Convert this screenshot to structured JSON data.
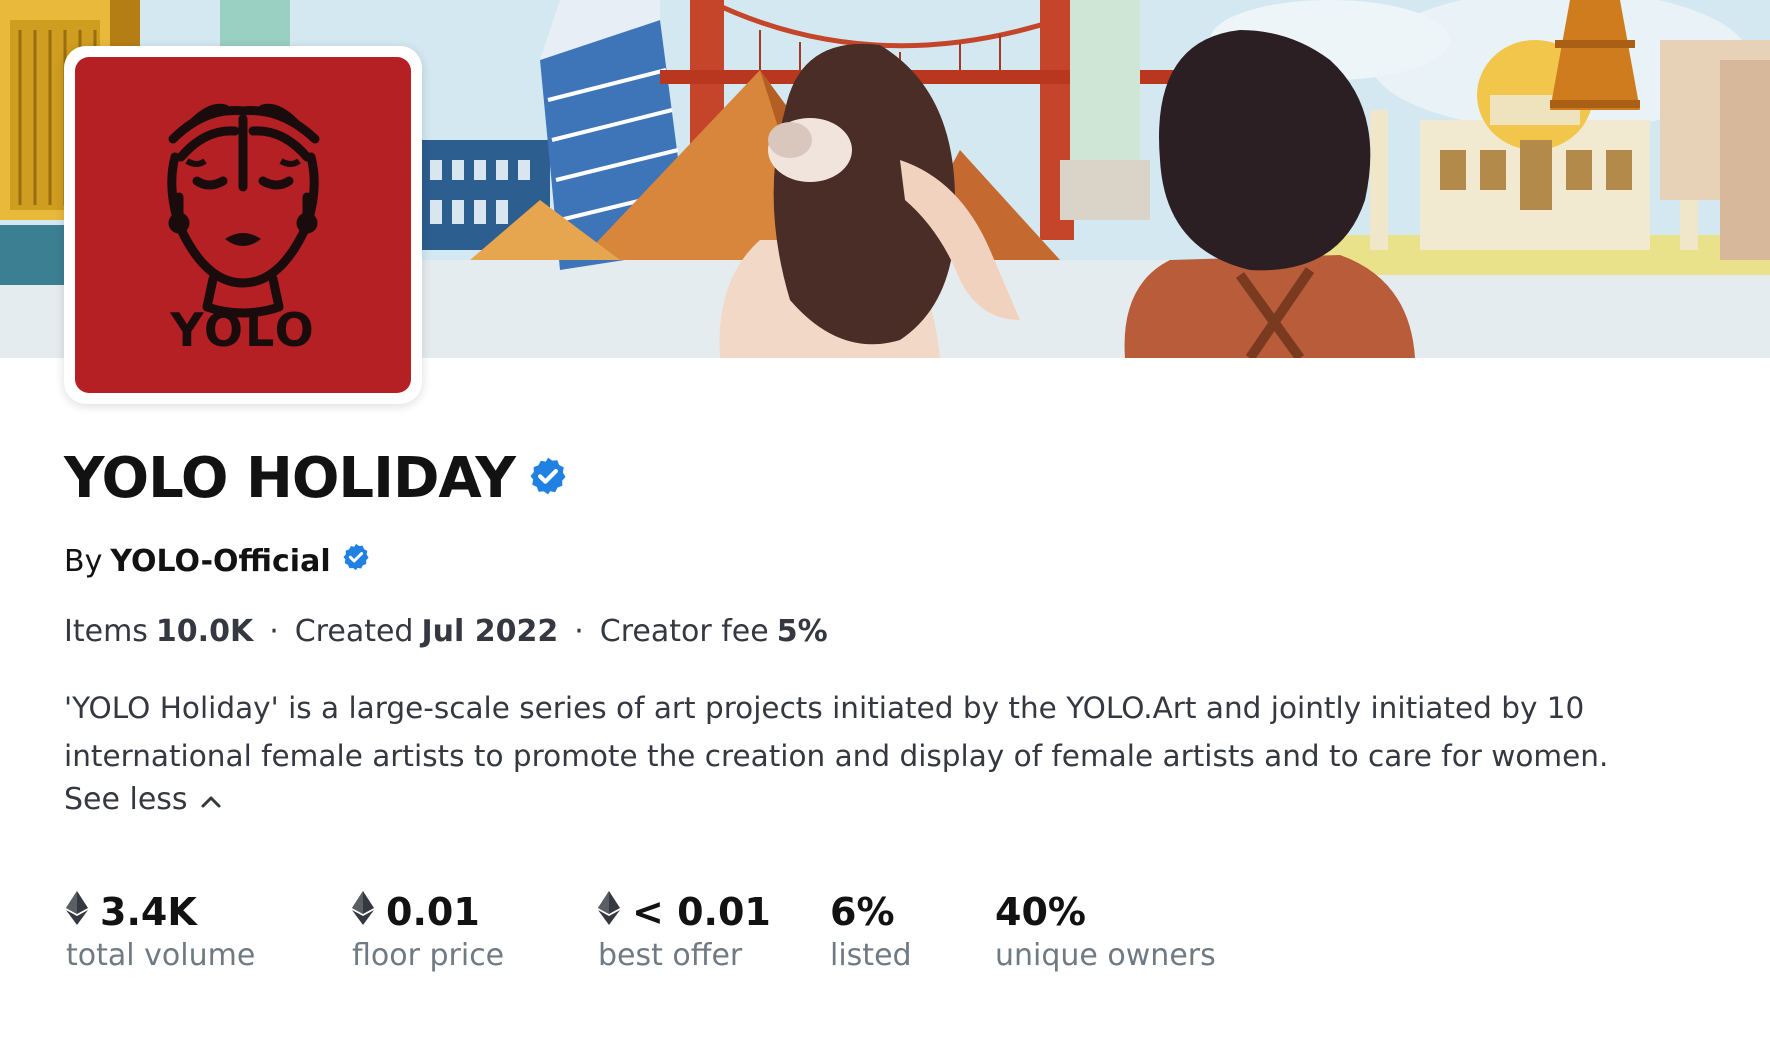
{
  "banner": {
    "description": "collection-banner"
  },
  "avatar": {
    "logo_text": "YOLO"
  },
  "collection": {
    "name": "YOLO HOLIDAY",
    "by_prefix": "By",
    "creator": "YOLO-Official",
    "items_label": "Items",
    "items_value": "10.0K",
    "created_label": "Created",
    "created_value": "Jul 2022",
    "fee_label": "Creator fee",
    "fee_value": "5%",
    "separator": "·",
    "description_line1": "'YOLO Holiday' is a large-scale series of art projects initiated by the YOLO.Art and jointly initiated by 10",
    "description_line2": "international female artists to promote the creation and display of female artists and to care for women.",
    "see_less": "See less"
  },
  "stats": [
    {
      "value": "3.4K",
      "label": "total volume",
      "eth": true
    },
    {
      "value": "0.01",
      "label": "floor price",
      "eth": true
    },
    {
      "value": "< 0.01",
      "label": "best offer",
      "eth": true
    },
    {
      "value": "6%",
      "label": "listed",
      "eth": false
    },
    {
      "value": "40%",
      "label": "unique owners",
      "eth": false
    }
  ],
  "colors": {
    "verified_blue": "#2081e2",
    "avatar_red": "#b42023",
    "text_primary": "#121212",
    "text_secondary": "#353840",
    "text_muted": "#707a83"
  }
}
